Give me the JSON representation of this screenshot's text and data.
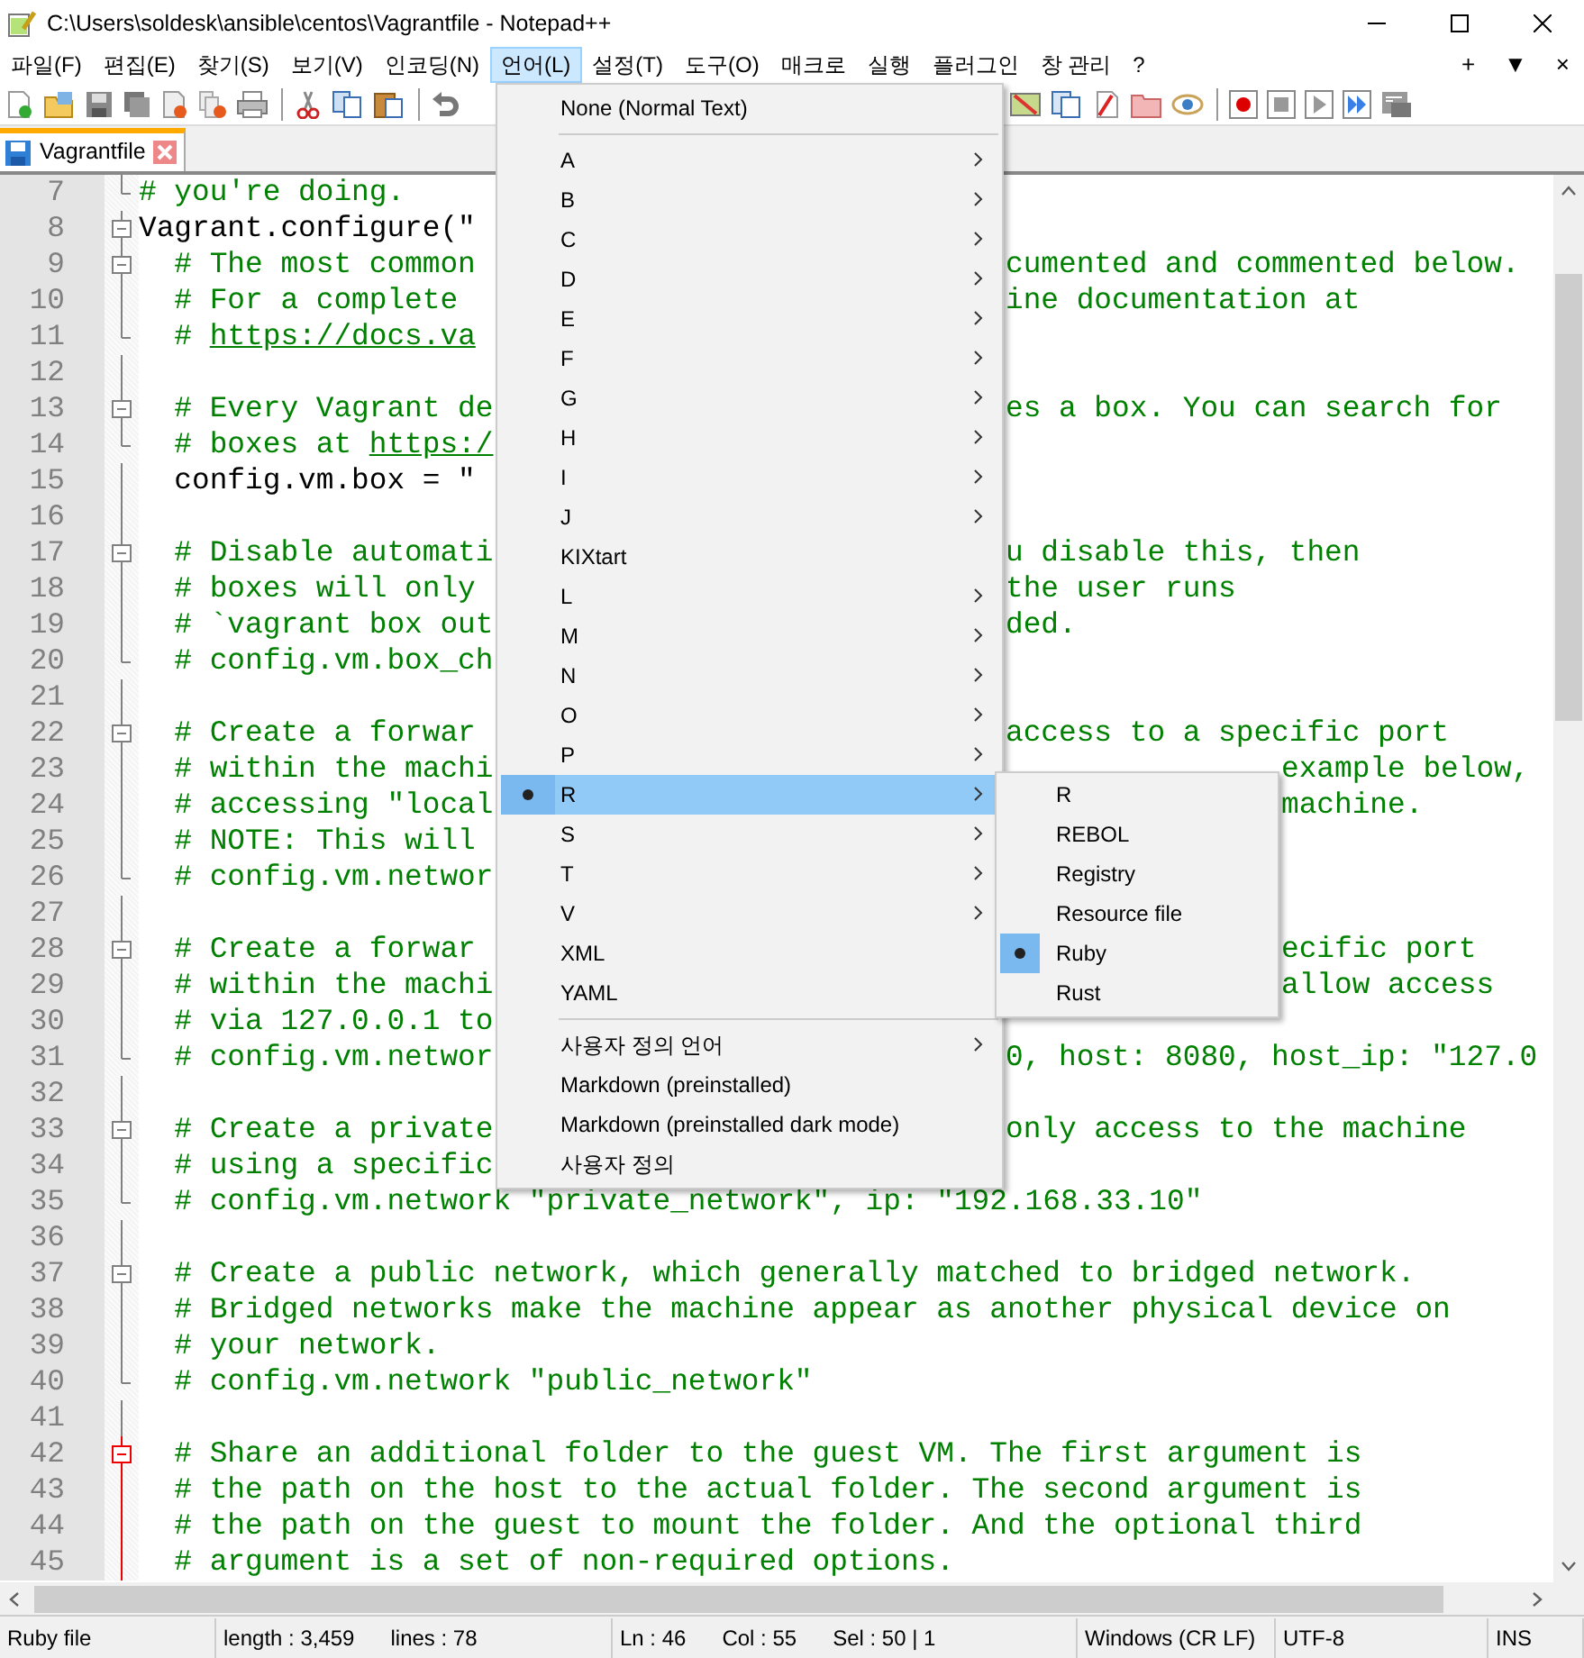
{
  "window": {
    "title": "C:\\Users\\soldesk\\ansible\\centos\\Vagrantfile - Notepad++"
  },
  "menubar": [
    {
      "label": "파일(F)",
      "selected": false
    },
    {
      "label": "편집(E)",
      "selected": false
    },
    {
      "label": "찾기(S)",
      "selected": false
    },
    {
      "label": "보기(V)",
      "selected": false
    },
    {
      "label": "인코딩(N)",
      "selected": false
    },
    {
      "label": "언어(L)",
      "selected": true
    },
    {
      "label": "설정(T)",
      "selected": false
    },
    {
      "label": "도구(O)",
      "selected": false
    },
    {
      "label": "매크로",
      "selected": false
    },
    {
      "label": "실행",
      "selected": false
    },
    {
      "label": "플러그인",
      "selected": false
    },
    {
      "label": "창 관리",
      "selected": false
    },
    {
      "label": "?",
      "selected": false
    }
  ],
  "menubar_right": [
    "+",
    "▼",
    "×"
  ],
  "tabs": [
    {
      "label": "Vagrantfile",
      "selected": true
    }
  ],
  "editor": {
    "lines": [
      {
        "number": "7",
        "kind": "comment",
        "text": "# you're doing.",
        "fold_start": false,
        "fold_end": true,
        "active": false
      },
      {
        "number": "8",
        "kind": "code",
        "text": "Vagrant.configure(\"",
        "fold_start": true,
        "fold_end": false,
        "active": false
      },
      {
        "number": "9",
        "kind": "comment",
        "text": "  # The most common",
        "tail": "cumented and commented below.",
        "fold_start": true,
        "fold_end": false,
        "active": false
      },
      {
        "number": "10",
        "kind": "comment",
        "text": "  # For a complete",
        "tail": "ine documentation at",
        "fold_start": false,
        "fold_end": false,
        "active": false
      },
      {
        "number": "11",
        "kind": "comment",
        "text": "  # ",
        "link": "https://docs.va",
        "fold_start": false,
        "fold_end": true,
        "active": false
      },
      {
        "number": "12",
        "fold_start": false,
        "fold_end": false,
        "active": false
      },
      {
        "number": "13",
        "kind": "comment",
        "text": "  # Every Vagrant de",
        "tail": "es a box. You can search for",
        "fold_start": true,
        "fold_end": false,
        "active": false
      },
      {
        "number": "14",
        "kind": "comment",
        "text": "  # boxes at ",
        "link": "https:/",
        "fold_start": false,
        "fold_end": true,
        "active": false
      },
      {
        "number": "15",
        "kind": "code",
        "text": "  config.vm.box = \"",
        "fold_start": false,
        "fold_end": false,
        "active": false
      },
      {
        "number": "16",
        "fold_start": false,
        "fold_end": false,
        "active": false
      },
      {
        "number": "17",
        "kind": "comment",
        "text": "  # Disable automati",
        "tail": "u disable this, then",
        "fold_start": true,
        "fold_end": false,
        "active": false
      },
      {
        "number": "18",
        "kind": "comment",
        "text": "  # boxes will only",
        "tail": "the user runs",
        "fold_start": false,
        "fold_end": false,
        "active": false
      },
      {
        "number": "19",
        "kind": "comment",
        "text": "  # `vagrant box out",
        "tail": "ded.",
        "fold_start": false,
        "fold_end": false,
        "active": false
      },
      {
        "number": "20",
        "kind": "comment",
        "text": "  # config.vm.box_ch",
        "fold_start": false,
        "fold_end": true,
        "active": false
      },
      {
        "number": "21",
        "fold_start": false,
        "fold_end": false,
        "active": false
      },
      {
        "number": "22",
        "kind": "comment",
        "text": "  # Create a forwar",
        "tail": "access to a specific port",
        "fold_start": true,
        "fold_end": false,
        "active": false
      },
      {
        "number": "23",
        "kind": "comment",
        "text": "  # within the machi",
        "tail": "example below,",
        "fold_start": false,
        "fold_end": false,
        "active": false
      },
      {
        "number": "24",
        "kind": "comment",
        "text": "  # accessing \"local",
        "tail": "machine.",
        "fold_start": false,
        "fold_end": false,
        "active": false
      },
      {
        "number": "25",
        "kind": "comment",
        "text": "  # NOTE: This will",
        "fold_start": false,
        "fold_end": false,
        "active": false
      },
      {
        "number": "26",
        "kind": "comment",
        "text": "  # config.vm.networ",
        "fold_start": false,
        "fold_end": true,
        "active": false
      },
      {
        "number": "27",
        "fold_start": false,
        "fold_end": false,
        "active": false
      },
      {
        "number": "28",
        "kind": "comment",
        "text": "  # Create a forwar",
        "tail": "ecific port",
        "fold_start": true,
        "fold_end": false,
        "active": false
      },
      {
        "number": "29",
        "kind": "comment",
        "text": "  # within the machi",
        "tail": "allow access",
        "fold_start": false,
        "fold_end": false,
        "active": false
      },
      {
        "number": "30",
        "kind": "comment",
        "text": "  # via 127.0.0.1 to",
        "fold_start": false,
        "fold_end": false,
        "active": false
      },
      {
        "number": "31",
        "kind": "comment",
        "text": "  # config.vm.networ",
        "tail": "0, host: 8080, host_ip: \"127.0",
        "fold_start": false,
        "fold_end": true,
        "active": false
      },
      {
        "number": "32",
        "fold_start": false,
        "fold_end": false,
        "active": false
      },
      {
        "number": "33",
        "kind": "comment",
        "text": "  # Create a private",
        "tail": "only access to the machine",
        "fold_start": true,
        "fold_end": false,
        "active": false
      },
      {
        "number": "34",
        "kind": "comment",
        "text": "  # using a specific",
        "fold_start": false,
        "fold_end": false,
        "active": false
      },
      {
        "number": "35",
        "kind": "comment",
        "text": "  # config.vm.network \"private_network\", ip: \"192.168.33.10\"",
        "fold_start": false,
        "fold_end": true,
        "active": false
      },
      {
        "number": "36",
        "fold_start": false,
        "fold_end": false,
        "active": false
      },
      {
        "number": "37",
        "kind": "comment",
        "text": "  # Create a public network, which generally matched to bridged network.",
        "fold_start": true,
        "fold_end": false,
        "active": false
      },
      {
        "number": "38",
        "kind": "comment",
        "text": "  # Bridged networks make the machine appear as another physical device on",
        "fold_start": false,
        "fold_end": false,
        "active": false
      },
      {
        "number": "39",
        "kind": "comment",
        "text": "  # your network.",
        "fold_start": false,
        "fold_end": false,
        "active": false
      },
      {
        "number": "40",
        "kind": "comment",
        "text": "  # config.vm.network \"public_network\"",
        "fold_start": false,
        "fold_end": true,
        "active": false
      },
      {
        "number": "41",
        "fold_start": false,
        "fold_end": false,
        "active": false
      },
      {
        "number": "42",
        "kind": "comment",
        "text": "  # Share an additional folder to the guest VM. The first argument is",
        "fold_start": true,
        "fold_end": false,
        "active": true
      },
      {
        "number": "43",
        "kind": "comment",
        "text": "  # the path on the host to the actual folder. The second argument is",
        "fold_start": false,
        "fold_end": false,
        "active": true
      },
      {
        "number": "44",
        "kind": "comment",
        "text": "  # the path on the guest to mount the folder. And the optional third",
        "fold_start": false,
        "fold_end": false,
        "active": true
      },
      {
        "number": "45",
        "kind": "comment",
        "text": "  # argument is a set of non-required options.",
        "fold_start": false,
        "fold_end": false,
        "active": true
      }
    ]
  },
  "language_menu": {
    "items": [
      {
        "kind": "item",
        "label": "None (Normal Text)",
        "submenu": false,
        "selected": false,
        "checked": false
      },
      {
        "kind": "separator"
      },
      {
        "kind": "item",
        "label": "A",
        "submenu": true,
        "selected": false,
        "checked": false
      },
      {
        "kind": "item",
        "label": "B",
        "submenu": true,
        "selected": false,
        "checked": false
      },
      {
        "kind": "item",
        "label": "C",
        "submenu": true,
        "selected": false,
        "checked": false
      },
      {
        "kind": "item",
        "label": "D",
        "submenu": true,
        "selected": false,
        "checked": false
      },
      {
        "kind": "item",
        "label": "E",
        "submenu": true,
        "selected": false,
        "checked": false
      },
      {
        "kind": "item",
        "label": "F",
        "submenu": true,
        "selected": false,
        "checked": false
      },
      {
        "kind": "item",
        "label": "G",
        "submenu": true,
        "selected": false,
        "checked": false
      },
      {
        "kind": "item",
        "label": "H",
        "submenu": true,
        "selected": false,
        "checked": false
      },
      {
        "kind": "item",
        "label": "I",
        "submenu": true,
        "selected": false,
        "checked": false
      },
      {
        "kind": "item",
        "label": "J",
        "submenu": true,
        "selected": false,
        "checked": false
      },
      {
        "kind": "item",
        "label": "KIXtart",
        "submenu": false,
        "selected": false,
        "checked": false
      },
      {
        "kind": "item",
        "label": "L",
        "submenu": true,
        "selected": false,
        "checked": false
      },
      {
        "kind": "item",
        "label": "M",
        "submenu": true,
        "selected": false,
        "checked": false
      },
      {
        "kind": "item",
        "label": "N",
        "submenu": true,
        "selected": false,
        "checked": false
      },
      {
        "kind": "item",
        "label": "O",
        "submenu": true,
        "selected": false,
        "checked": false
      },
      {
        "kind": "item",
        "label": "P",
        "submenu": true,
        "selected": false,
        "checked": false
      },
      {
        "kind": "item",
        "label": "R",
        "submenu": true,
        "selected": true,
        "checked": true
      },
      {
        "kind": "item",
        "label": "S",
        "submenu": true,
        "selected": false,
        "checked": false
      },
      {
        "kind": "item",
        "label": "T",
        "submenu": true,
        "selected": false,
        "checked": false
      },
      {
        "kind": "item",
        "label": "V",
        "submenu": true,
        "selected": false,
        "checked": false
      },
      {
        "kind": "item",
        "label": "XML",
        "submenu": false,
        "selected": false,
        "checked": false
      },
      {
        "kind": "item",
        "label": "YAML",
        "submenu": false,
        "selected": false,
        "checked": false
      },
      {
        "kind": "separator"
      },
      {
        "kind": "item",
        "label": "사용자 정의 언어",
        "submenu": true,
        "selected": false,
        "checked": false
      },
      {
        "kind": "item",
        "label": "Markdown (preinstalled)",
        "submenu": false,
        "selected": false,
        "checked": false
      },
      {
        "kind": "item",
        "label": "Markdown (preinstalled dark mode)",
        "submenu": false,
        "selected": false,
        "checked": false
      },
      {
        "kind": "item",
        "label": "사용자 정의",
        "submenu": false,
        "selected": false,
        "checked": false
      }
    ]
  },
  "r_submenu": {
    "items": [
      {
        "label": "R",
        "checked": false
      },
      {
        "label": "REBOL",
        "checked": false
      },
      {
        "label": "Registry",
        "checked": false
      },
      {
        "label": "Resource file",
        "checked": false
      },
      {
        "label": "Ruby",
        "checked": true
      },
      {
        "label": "Rust",
        "checked": false
      }
    ]
  },
  "status_bar": [
    {
      "texts": [
        "Ruby file"
      ]
    },
    {
      "texts": [
        "length : 3,459",
        "lines : 78"
      ]
    },
    {
      "texts": [
        "Ln : 46",
        "Col : 55",
        "Sel : 50 | 1"
      ]
    },
    {
      "texts": [
        "Windows (CR LF)"
      ]
    },
    {
      "texts": [
        "UTF-8"
      ]
    },
    {
      "texts": [
        "INS"
      ]
    }
  ]
}
